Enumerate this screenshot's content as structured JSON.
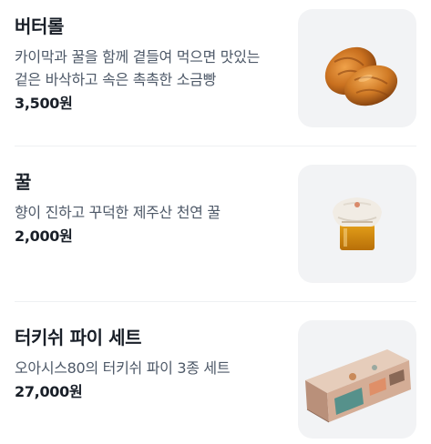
{
  "menu": {
    "items": [
      {
        "name": "버터롤",
        "description": "카이막과 꿀을 함께 곁들여 먹으면 맛있는 겉은 바삭하고 속은 촉촉한 소금빵",
        "price": "3,500원",
        "image_icon": "butter-roll-image"
      },
      {
        "name": "꿀",
        "description": "향이 진하고 꾸덕한 제주산 천연 꿀",
        "price": "2,000원",
        "image_icon": "honey-jar-image"
      },
      {
        "name": "터키쉬 파이 세트",
        "description": "오아시스80의 터키쉬 파이 3종 세트",
        "price": "27,000원",
        "image_icon": "pie-box-image"
      }
    ]
  },
  "colors": {
    "text_primary": "#191f28",
    "text_secondary": "#4e5968",
    "thumb_background": "#f2f3f5",
    "divider": "#eef0f3"
  }
}
